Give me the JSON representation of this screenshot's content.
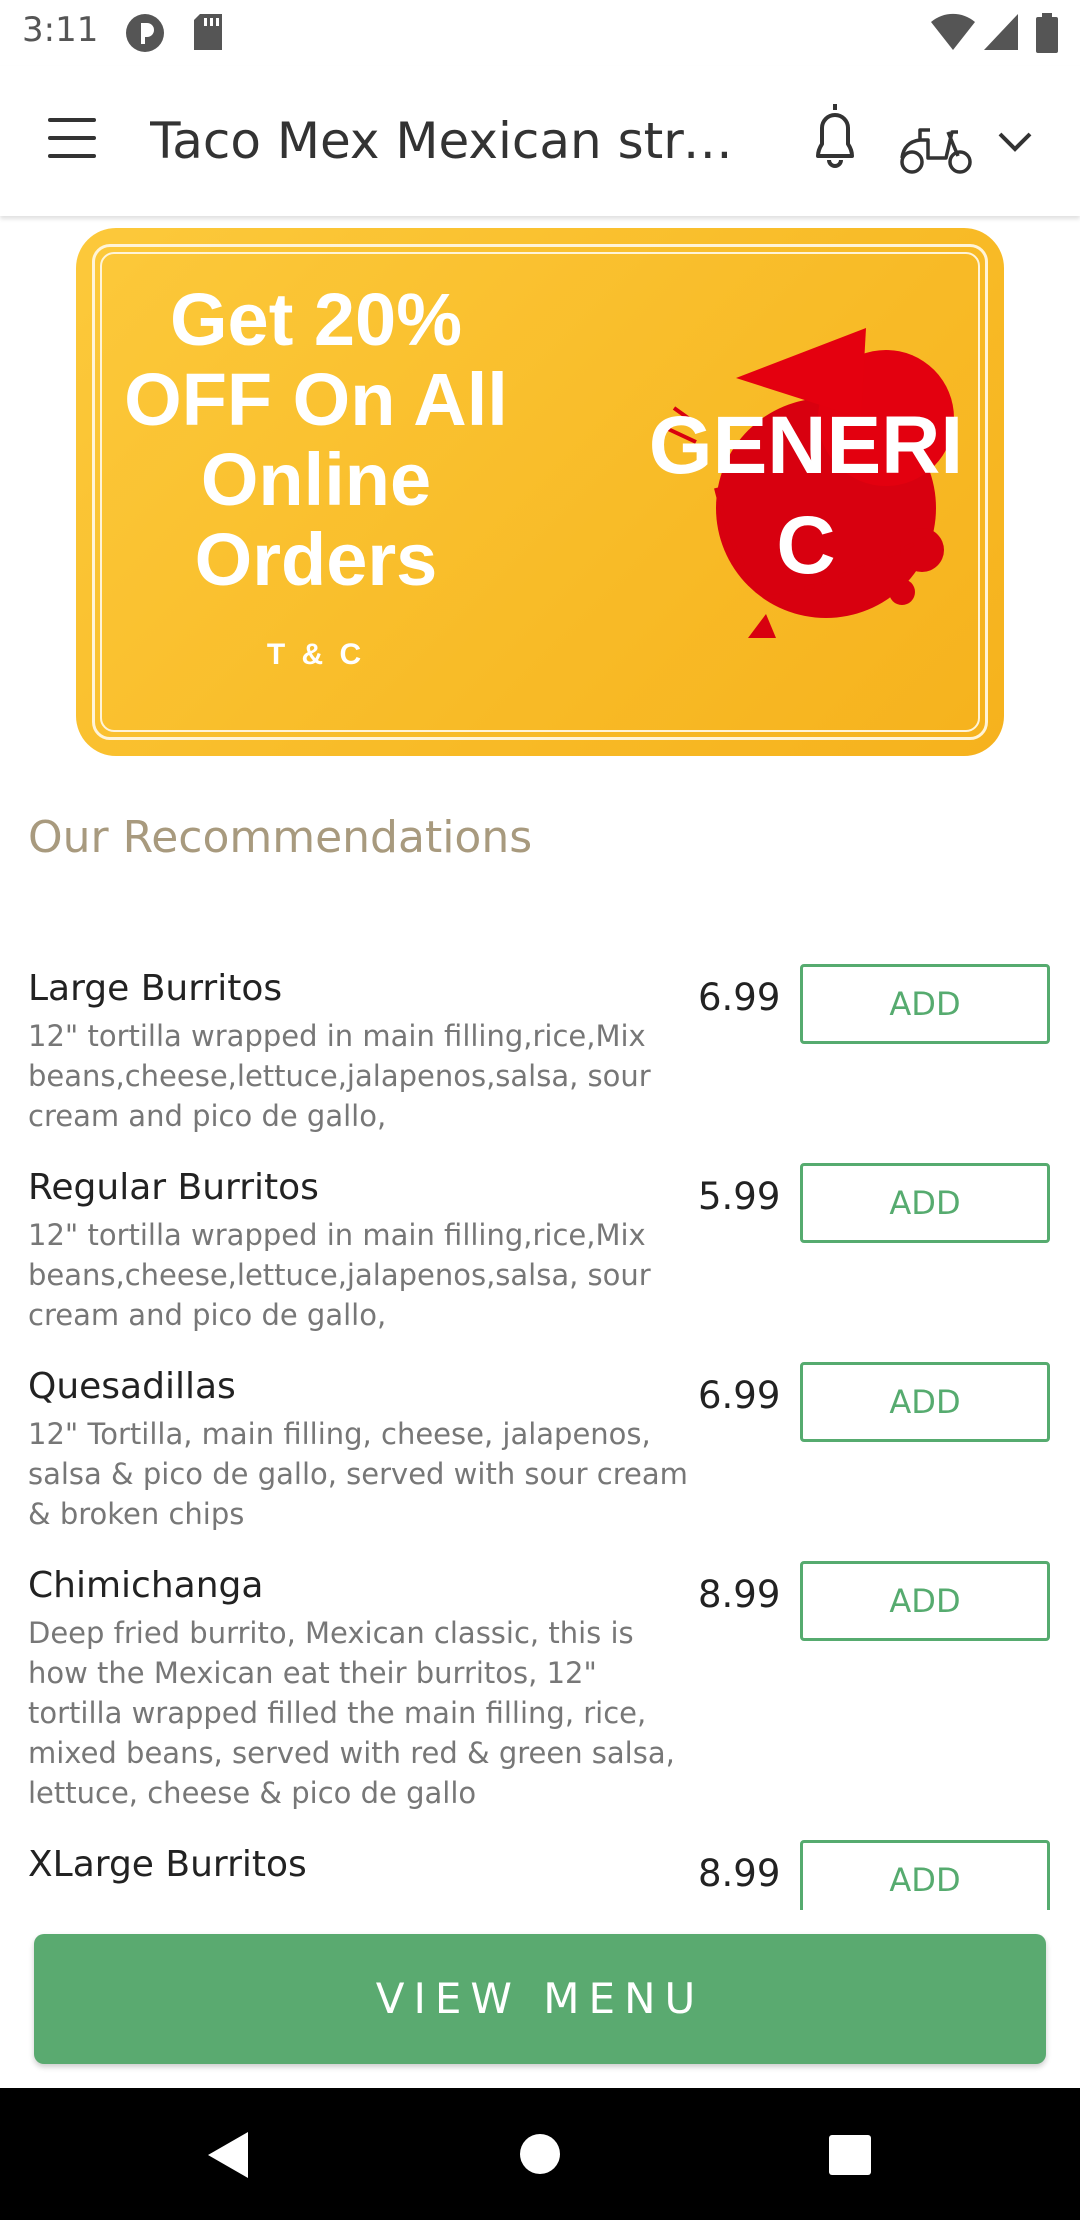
{
  "status_bar": {
    "time": "3:11"
  },
  "app_bar": {
    "title": "Taco Mex Mexican stre..."
  },
  "banner": {
    "promo_lines": [
      "Get 20%",
      "OFF On All",
      "Online",
      "Orders"
    ],
    "terms": "T & C",
    "brand_text": "GENERI C"
  },
  "section": {
    "title": "Our Recommendations"
  },
  "items": [
    {
      "name": "Large Burritos",
      "price": "6.99",
      "add_label": "ADD",
      "desc": "12\" tortilla wrapped in main filling,rice,Mix beans,cheese,lettuce,jalapenos,salsa, sour cream and pico de gallo,"
    },
    {
      "name": "Regular Burritos",
      "price": "5.99",
      "add_label": "ADD",
      "desc": "12\" tortilla wrapped in main filling,rice,Mix beans,cheese,lettuce,jalapenos,salsa, sour cream and pico de gallo,"
    },
    {
      "name": "Quesadillas",
      "price": "6.99",
      "add_label": "ADD",
      "desc": "12\" Tortilla, main filling, cheese, jalapenos, salsa & pico de gallo, served with sour cream & broken chips"
    },
    {
      "name": "Chimichanga",
      "price": "8.99",
      "add_label": "ADD",
      "desc": "Deep fried burrito, Mexican classic, this is how the Mexican eat their burritos, 12\" tortilla wrapped filled the main filling, rice, mixed beans, served with red & green salsa, lettuce, cheese & pico de gallo"
    },
    {
      "name": "XLarge Burritos",
      "price": "8.99",
      "add_label": "ADD",
      "desc": ""
    }
  ],
  "view_menu": {
    "label": "VIEW MENU"
  },
  "colors": {
    "accent_green": "#5aaa70",
    "banner_yellow": "#f8bb27",
    "section_title": "#a89a7e"
  }
}
